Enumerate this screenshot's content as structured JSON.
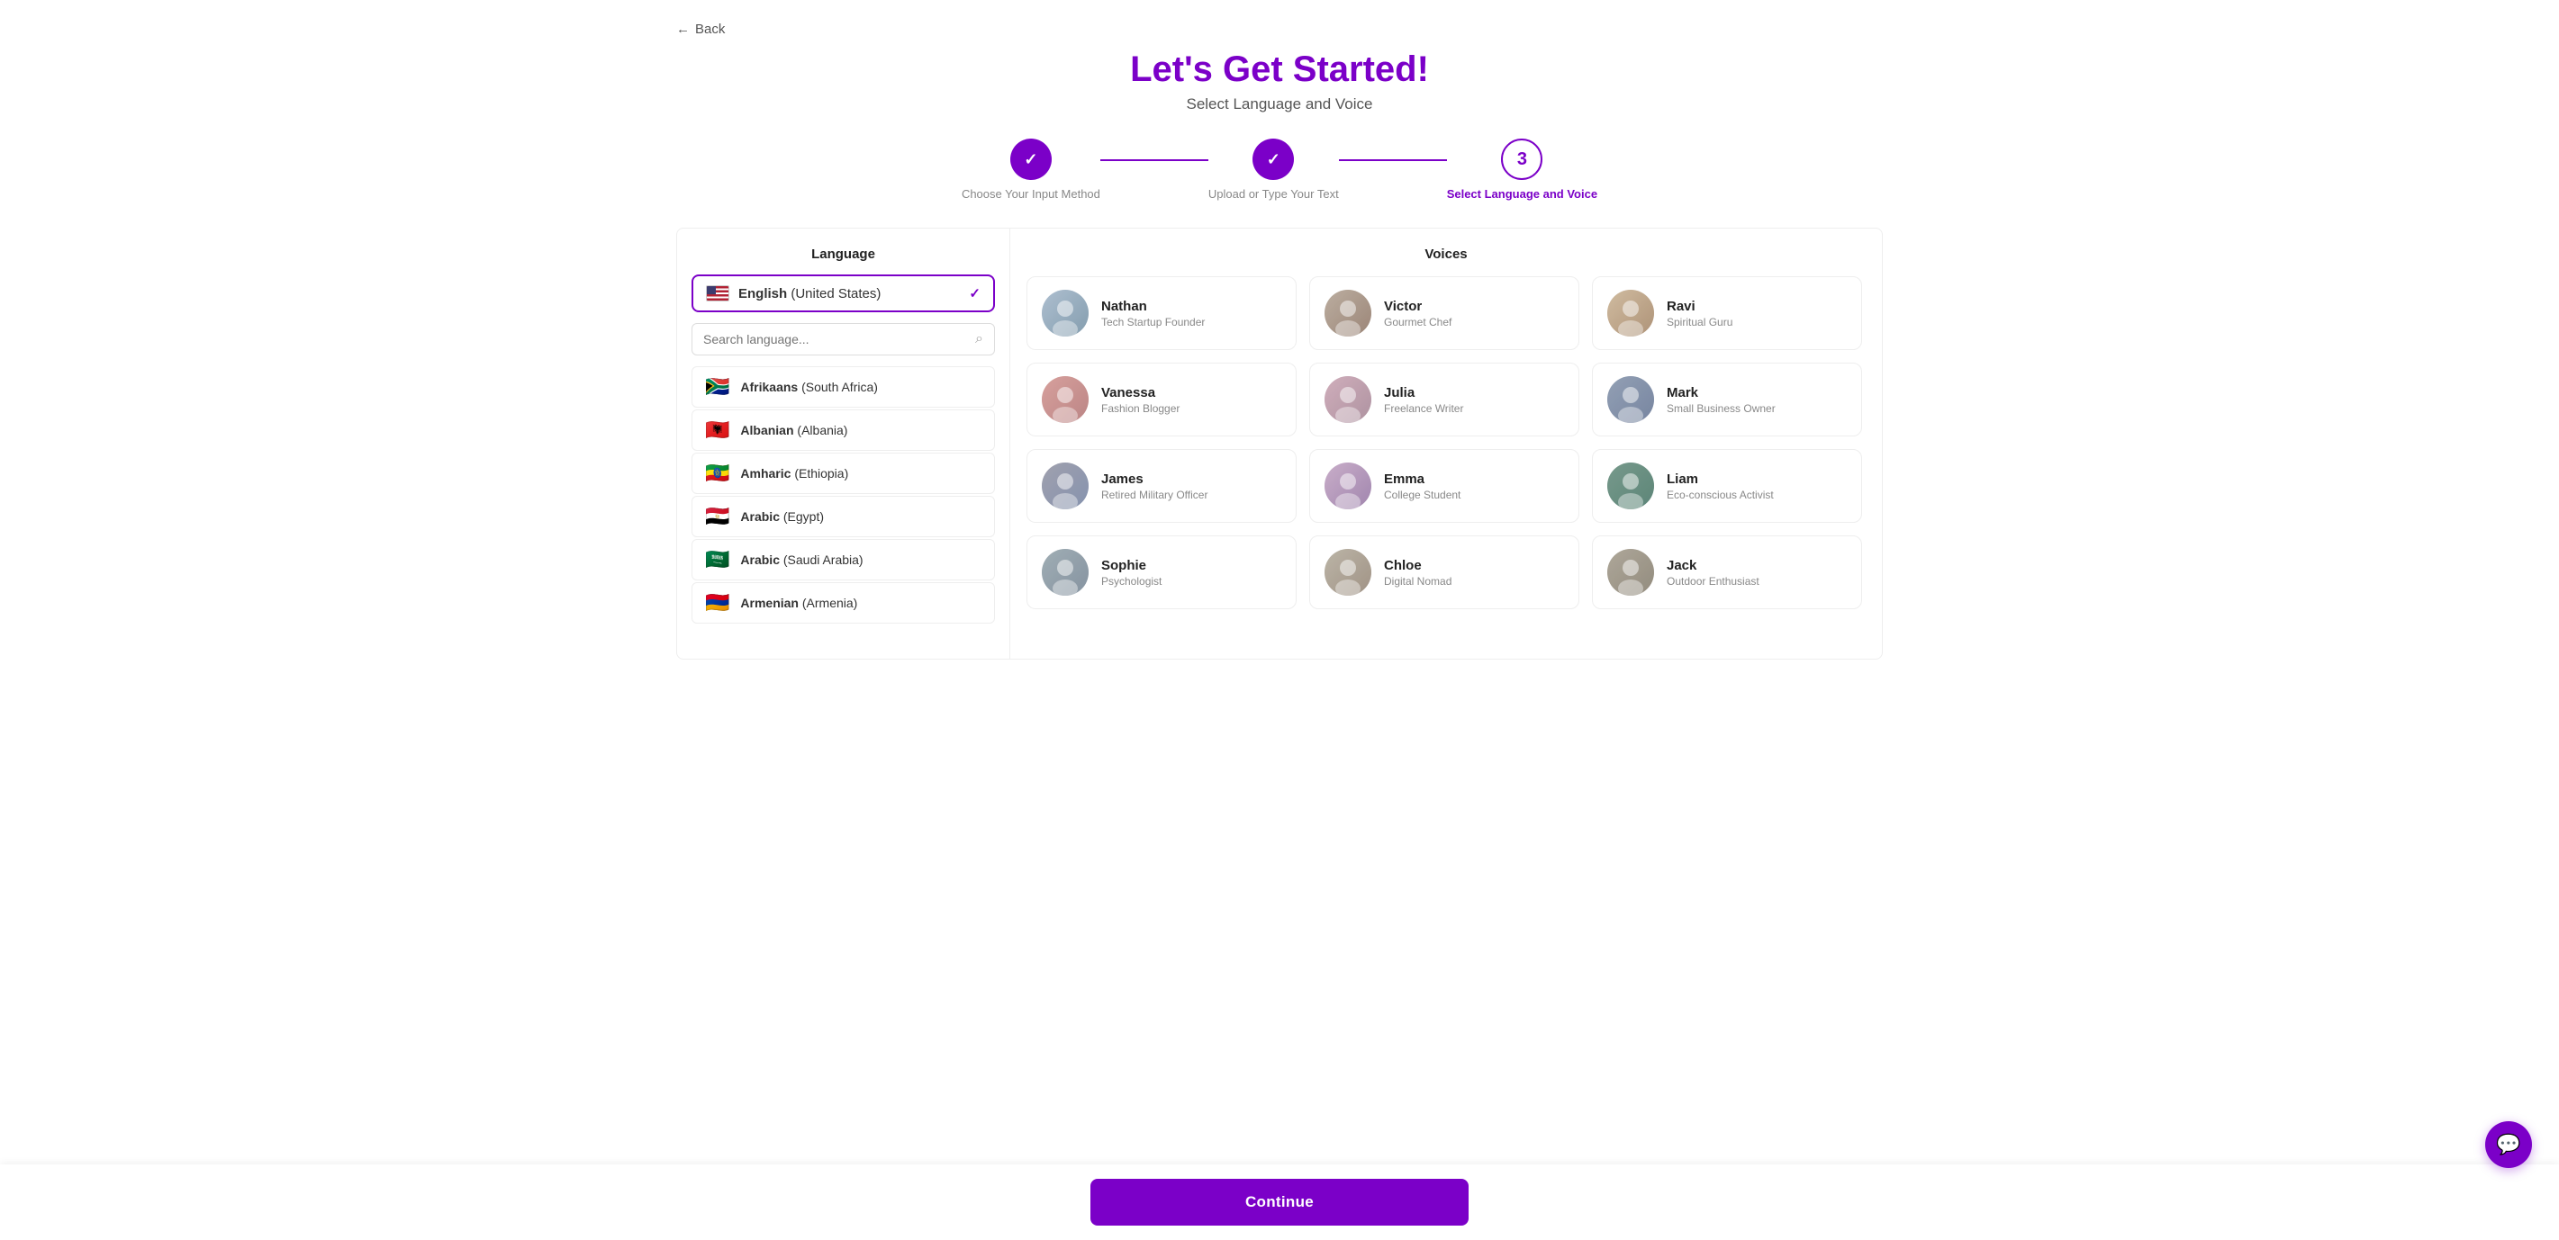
{
  "page": {
    "title": "Let's Get Started!",
    "subtitle": "Select Language and Voice"
  },
  "back_button": {
    "label": "Back",
    "arrow": "←"
  },
  "stepper": {
    "steps": [
      {
        "id": 1,
        "label": "Choose Your Input Method",
        "state": "done"
      },
      {
        "id": 2,
        "label": "Upload or Type Your Text",
        "state": "done"
      },
      {
        "id": 3,
        "label": "Select Language and Voice",
        "state": "active"
      }
    ]
  },
  "language_panel": {
    "title": "Language",
    "selected": {
      "name": "English",
      "region": "(United States)"
    },
    "search_placeholder": "Search language...",
    "languages": [
      {
        "id": "af",
        "flag": "🇿🇦",
        "name": "Afrikaans",
        "region": "(South Africa)"
      },
      {
        "id": "sq",
        "flag": "🇦🇱",
        "name": "Albanian",
        "region": "(Albania)"
      },
      {
        "id": "am",
        "flag": "🇪🇹",
        "name": "Amharic",
        "region": "(Ethiopia)"
      },
      {
        "id": "ar-eg",
        "flag": "🇪🇬",
        "name": "Arabic",
        "region": "(Egypt)"
      },
      {
        "id": "ar-sa",
        "flag": "🇸🇦",
        "name": "Arabic",
        "region": "(Saudi Arabia)"
      },
      {
        "id": "hy",
        "flag": "🇦🇲",
        "name": "Armenian",
        "region": "(Armenia)"
      }
    ]
  },
  "voices_panel": {
    "title": "Voices",
    "voices": [
      {
        "id": 1,
        "name": "Nathan",
        "role": "Tech Startup Founder",
        "avatar_class": "avatar-bg-1",
        "emoji": "👨"
      },
      {
        "id": 2,
        "name": "Victor",
        "role": "Gourmet Chef",
        "avatar_class": "avatar-bg-2",
        "emoji": "👨‍🍳"
      },
      {
        "id": 3,
        "name": "Ravi",
        "role": "Spiritual Guru",
        "avatar_class": "avatar-bg-3",
        "emoji": "🧔"
      },
      {
        "id": 4,
        "name": "Vanessa",
        "role": "Fashion Blogger",
        "avatar_class": "avatar-bg-4",
        "emoji": "👩"
      },
      {
        "id": 5,
        "name": "Julia",
        "role": "Freelance Writer",
        "avatar_class": "avatar-bg-5",
        "emoji": "👩‍💼"
      },
      {
        "id": 6,
        "name": "Mark",
        "role": "Small Business Owner",
        "avatar_class": "avatar-bg-6",
        "emoji": "👨‍💼"
      },
      {
        "id": 7,
        "name": "James",
        "role": "Retired Military Officer",
        "avatar_class": "avatar-bg-7",
        "emoji": "👴"
      },
      {
        "id": 8,
        "name": "Emma",
        "role": "College Student",
        "avatar_class": "avatar-bg-8",
        "emoji": "👩‍🎓"
      },
      {
        "id": 9,
        "name": "Liam",
        "role": "Eco-conscious Activist",
        "avatar_class": "avatar-bg-11",
        "emoji": "🧑‍🌾"
      },
      {
        "id": 10,
        "name": "Sophie",
        "role": "Psychologist",
        "avatar_class": "avatar-bg-9",
        "emoji": "👩‍⚕️"
      },
      {
        "id": 11,
        "name": "Chloe",
        "role": "Digital Nomad",
        "avatar_class": "avatar-bg-10",
        "emoji": "👩‍💻"
      },
      {
        "id": 12,
        "name": "Jack",
        "role": "Outdoor Enthusiast",
        "avatar_class": "avatar-bg-12",
        "emoji": "🧔"
      }
    ]
  },
  "continue_button": {
    "label": "Continue"
  },
  "chat_bubble": {
    "icon": "💬"
  }
}
